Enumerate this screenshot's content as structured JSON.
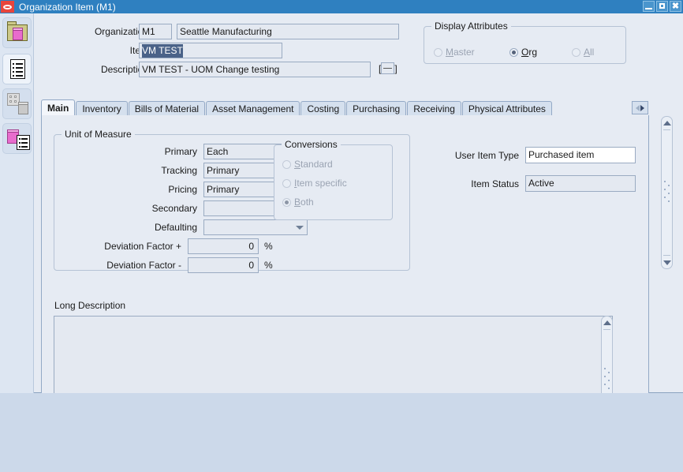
{
  "window": {
    "title": "Organization Item (M1)",
    "logo_icon": "oracle-logo-icon",
    "minimize_label": "",
    "maximize_label": "",
    "close_label": "✖",
    "titlebar_color": "#2f80c0"
  },
  "sidebar": {
    "items": [
      {
        "name": "folder-item-icon",
        "label": ""
      },
      {
        "name": "document-list-icon",
        "label": ""
      },
      {
        "name": "organization-item-icon",
        "label": ""
      },
      {
        "name": "item-attributes-icon",
        "label": ""
      }
    ]
  },
  "header": {
    "organization_label": "Organization",
    "organization_code": "M1",
    "organization_name": "Seattle Manufacturing",
    "item_label": "Item",
    "item_value": "VM TEST",
    "description_label": "Description",
    "description_value": "VM TEST - UOM Change testing",
    "flex_open": "[",
    "flex_close": "]"
  },
  "display_attributes": {
    "title": "Display Attributes",
    "options": [
      {
        "label": "Master",
        "mnemonic": "M",
        "rest": "aster",
        "selected": false,
        "enabled": false
      },
      {
        "label": "Org",
        "mnemonic": "O",
        "rest": "rg",
        "selected": true,
        "enabled": true
      },
      {
        "label": "All",
        "mnemonic": "A",
        "rest": "ll",
        "selected": false,
        "enabled": false
      }
    ]
  },
  "tabs": {
    "items": [
      {
        "label": "Main",
        "active": true
      },
      {
        "label": "Inventory",
        "active": false
      },
      {
        "label": "Bills of Material",
        "active": false
      },
      {
        "label": "Asset Management",
        "active": false
      },
      {
        "label": "Costing",
        "active": false
      },
      {
        "label": "Purchasing",
        "active": false
      },
      {
        "label": "Receiving",
        "active": false
      },
      {
        "label": "Physical Attributes",
        "active": false
      }
    ],
    "scroll_icon": "tab-scroll-right-icon"
  },
  "unit_of_measure": {
    "title": "Unit of Measure",
    "primary_label": "Primary",
    "primary_value": "Each",
    "tracking_label": "Tracking",
    "tracking_value": "Primary",
    "pricing_label": "Pricing",
    "pricing_value": "Primary",
    "secondary_label": "Secondary",
    "secondary_value": "",
    "defaulting_label": "Defaulting",
    "defaulting_value": "",
    "deviation_plus_label": "Deviation Factor +",
    "deviation_plus_value": "0",
    "deviation_minus_label": "Deviation Factor -",
    "deviation_minus_value": "0",
    "percent_symbol": "%"
  },
  "conversions": {
    "title": "Conversions",
    "options": [
      {
        "label": "Standard",
        "mnemonic": "S",
        "rest": "tandard",
        "selected": false,
        "enabled": false
      },
      {
        "label": "Item specific",
        "mnemonic": "I",
        "rest": "tem specific",
        "selected": false,
        "enabled": false
      },
      {
        "label": "Both",
        "mnemonic": "B",
        "rest": "oth",
        "selected": true,
        "enabled": false
      }
    ]
  },
  "item_details": {
    "user_item_type_label": "User Item Type",
    "user_item_type_value": "Purchased item",
    "item_status_label": "Item Status",
    "item_status_value": "Active"
  },
  "long_description": {
    "label": "Long Description",
    "value": ""
  },
  "colors": {
    "title_bar": "#2f80c0",
    "canvas": "#e6ebf3",
    "field": "#e4e9f1",
    "field_editable": "#ffffff",
    "selection": "#4a6288",
    "border": "#9aabc2",
    "accent_cube": "#e86ccd"
  }
}
